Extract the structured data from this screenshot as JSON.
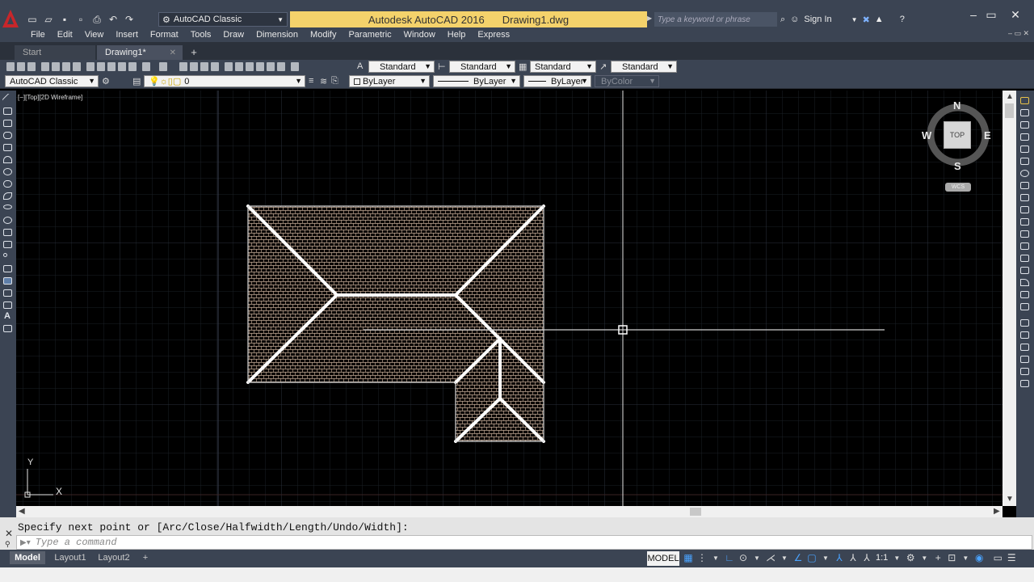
{
  "window": {
    "app_title": "Autodesk AutoCAD 2016",
    "file_title": "Drawing1.dwg",
    "workspace": "AutoCAD Classic",
    "search_placeholder": "Type a keyword or phrase",
    "sign_in": "Sign In"
  },
  "menu": [
    "File",
    "Edit",
    "View",
    "Insert",
    "Format",
    "Tools",
    "Draw",
    "Dimension",
    "Modify",
    "Parametric",
    "Window",
    "Help",
    "Express"
  ],
  "tabs": {
    "start": "Start",
    "active": "Drawing1*"
  },
  "toolbar1": {
    "text_style": "Standard",
    "dim_style": "Standard",
    "table_style": "Standard",
    "mleader_style": "Standard"
  },
  "toolbar2": {
    "workspace": "AutoCAD Classic",
    "layer": "0",
    "color": "ByLayer",
    "linetype": "ByLayer",
    "lineweight": "ByLayer",
    "plotstyle": "ByColor"
  },
  "viewport": {
    "label": "[−][Top][2D Wireframe]",
    "viewcube": {
      "n": "N",
      "s": "S",
      "e": "E",
      "w": "W",
      "face": "TOP",
      "wcs": "WCS"
    },
    "ucs": {
      "x": "X",
      "y": "Y"
    }
  },
  "command": {
    "history": "Specify next point or [Arc/Close/Halfwidth/Length/Undo/Width]:",
    "placeholder": "Type a command"
  },
  "layout_tabs": [
    "Model",
    "Layout1",
    "Layout2"
  ],
  "status": {
    "model": "MODEL",
    "scale": "1:1"
  },
  "colors": {
    "accent_yellow": "#f4d26b",
    "ui_dark": "#3b4453",
    "canvas": "#000000",
    "roof_line": "#ffffff",
    "hatch": "#b9a28f"
  }
}
